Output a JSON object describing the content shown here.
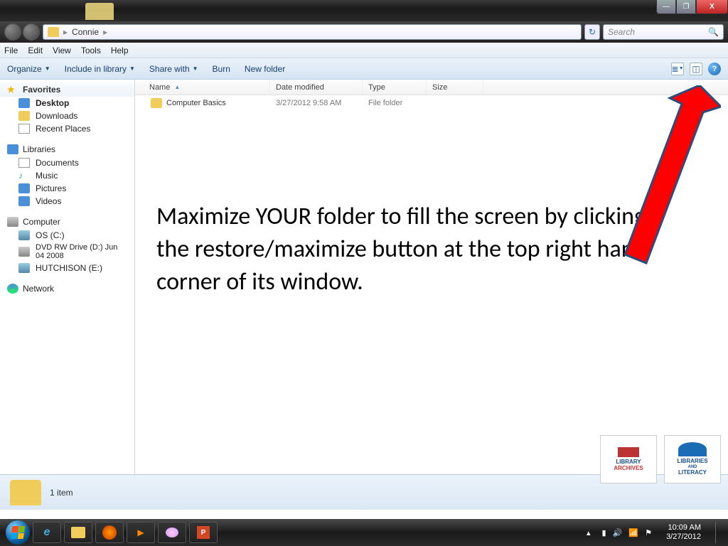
{
  "titlebar": {
    "min": "—",
    "max": "❐",
    "close": "X"
  },
  "breadcrumb": {
    "folder": "Connie",
    "sep": "▸"
  },
  "search": {
    "placeholder": "Search"
  },
  "menu": {
    "file": "File",
    "edit": "Edit",
    "view": "View",
    "tools": "Tools",
    "help": "Help"
  },
  "toolbar": {
    "organize": "Organize",
    "include": "Include in library",
    "share": "Share with",
    "burn": "Burn",
    "newfolder": "New folder"
  },
  "sidebar": {
    "fav_hdr": "Favorites",
    "favs": [
      "Desktop",
      "Downloads",
      "Recent Places"
    ],
    "lib_hdr": "Libraries",
    "libs": [
      "Documents",
      "Music",
      "Pictures",
      "Videos"
    ],
    "comp_hdr": "Computer",
    "drives": [
      "OS (C:)",
      "DVD RW Drive (D:) Jun 04 2008",
      "HUTCHISON (E:)"
    ],
    "net_hdr": "Network"
  },
  "columns": {
    "name": "Name",
    "date": "Date modified",
    "type": "Type",
    "size": "Size"
  },
  "files": [
    {
      "name": "Computer Basics",
      "date": "3/27/2012 9:58 AM",
      "type": "File folder",
      "size": ""
    }
  ],
  "instruction": "Maximize YOUR folder to fill the screen by clicking the restore/maximize button at the top right hand corner of its window.",
  "status": {
    "count": "1 item"
  },
  "logos": {
    "l1a": "LIBRARY",
    "l1b": "ARCHIVES",
    "l2a": "LIBRARIES",
    "l2b": "AND",
    "l2c": "LITERACY"
  },
  "tray": {
    "time": "10:09 AM",
    "date": "3/27/2012",
    "chev": "▴"
  }
}
